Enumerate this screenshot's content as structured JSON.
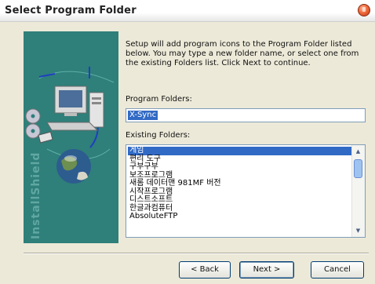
{
  "window": {
    "title": "Select Program Folder"
  },
  "sidebar": {
    "vertical_text": "InstallShield"
  },
  "intro_text": "Setup will add program icons to the Program Folder listed below. You may type a new folder name, or select one from the existing Folders list. Click Next to continue.",
  "program_folder": {
    "label": "Program Folders:",
    "value": "X-Sync"
  },
  "existing_folders": {
    "label": "Existing Folders:",
    "items": [
      "게임",
      "편리 도구",
      "구부구부",
      "보조프로그램",
      "새롬 데이터맨 981MF 버전",
      "시작프로그램",
      "디스트소프트",
      "한글과컴퓨터",
      "AbsoluteFTP"
    ],
    "selected_index": 0
  },
  "buttons": {
    "back": "< Back",
    "next": "Next >",
    "cancel": "Cancel"
  },
  "colors": {
    "sidebar_bg": "#2f7f7a",
    "selection": "#316ac5"
  }
}
